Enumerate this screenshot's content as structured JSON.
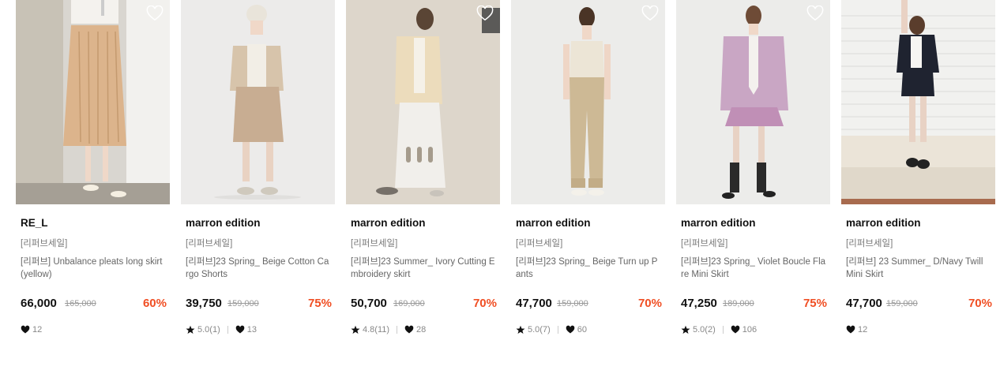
{
  "products": [
    {
      "brand": "RE_L",
      "sale_tag": "[리퍼브세일]",
      "name": "[리퍼브] Unbalance pleats long skirt (yellow)",
      "price": "66,000",
      "original_price": "165,000",
      "discount": "60%",
      "rating": "",
      "likes": "12",
      "wishlist_icon": "heart-outline-icon"
    },
    {
      "brand": "marron edition",
      "sale_tag": "[리퍼브세일]",
      "name": "[리퍼브]23 Spring_ Beige Cotton Cargo Shorts",
      "price": "39,750",
      "original_price": "159,000",
      "discount": "75%",
      "rating": "5.0(1)",
      "likes": "13",
      "wishlist_icon": "heart-outline-icon"
    },
    {
      "brand": "marron edition",
      "sale_tag": "[리퍼브세일]",
      "name": "[리퍼브]23 Summer_ Ivory Cutting Embroidery skirt",
      "price": "50,700",
      "original_price": "169,000",
      "discount": "70%",
      "rating": "4.8(11)",
      "likes": "28",
      "wishlist_icon": "heart-outline-icon"
    },
    {
      "brand": "marron edition",
      "sale_tag": "[리퍼브세일]",
      "name": "[리퍼브]23 Spring_ Beige Turn up Pants",
      "price": "47,700",
      "original_price": "159,000",
      "discount": "70%",
      "rating": "5.0(7)",
      "likes": "60",
      "wishlist_icon": "heart-outline-icon"
    },
    {
      "brand": "marron edition",
      "sale_tag": "[리퍼브세일]",
      "name": "[리퍼브]23 Spring_ Violet Boucle Flare Mini Skirt",
      "price": "47,250",
      "original_price": "189,000",
      "discount": "75%",
      "rating": "5.0(2)",
      "likes": "106",
      "wishlist_icon": "heart-outline-icon"
    },
    {
      "brand": "marron edition",
      "sale_tag": "[리퍼브세일]",
      "name": "[리퍼브] 23 Summer_ D/Navy Twill Mini Skirt",
      "price": "47,700",
      "original_price": "159,000",
      "discount": "70%",
      "rating": "",
      "likes": "12",
      "wishlist_icon": "heart-outline-icon"
    }
  ],
  "colors": {
    "discount": "#f04e23",
    "text": "#111111",
    "muted": "#888888"
  }
}
